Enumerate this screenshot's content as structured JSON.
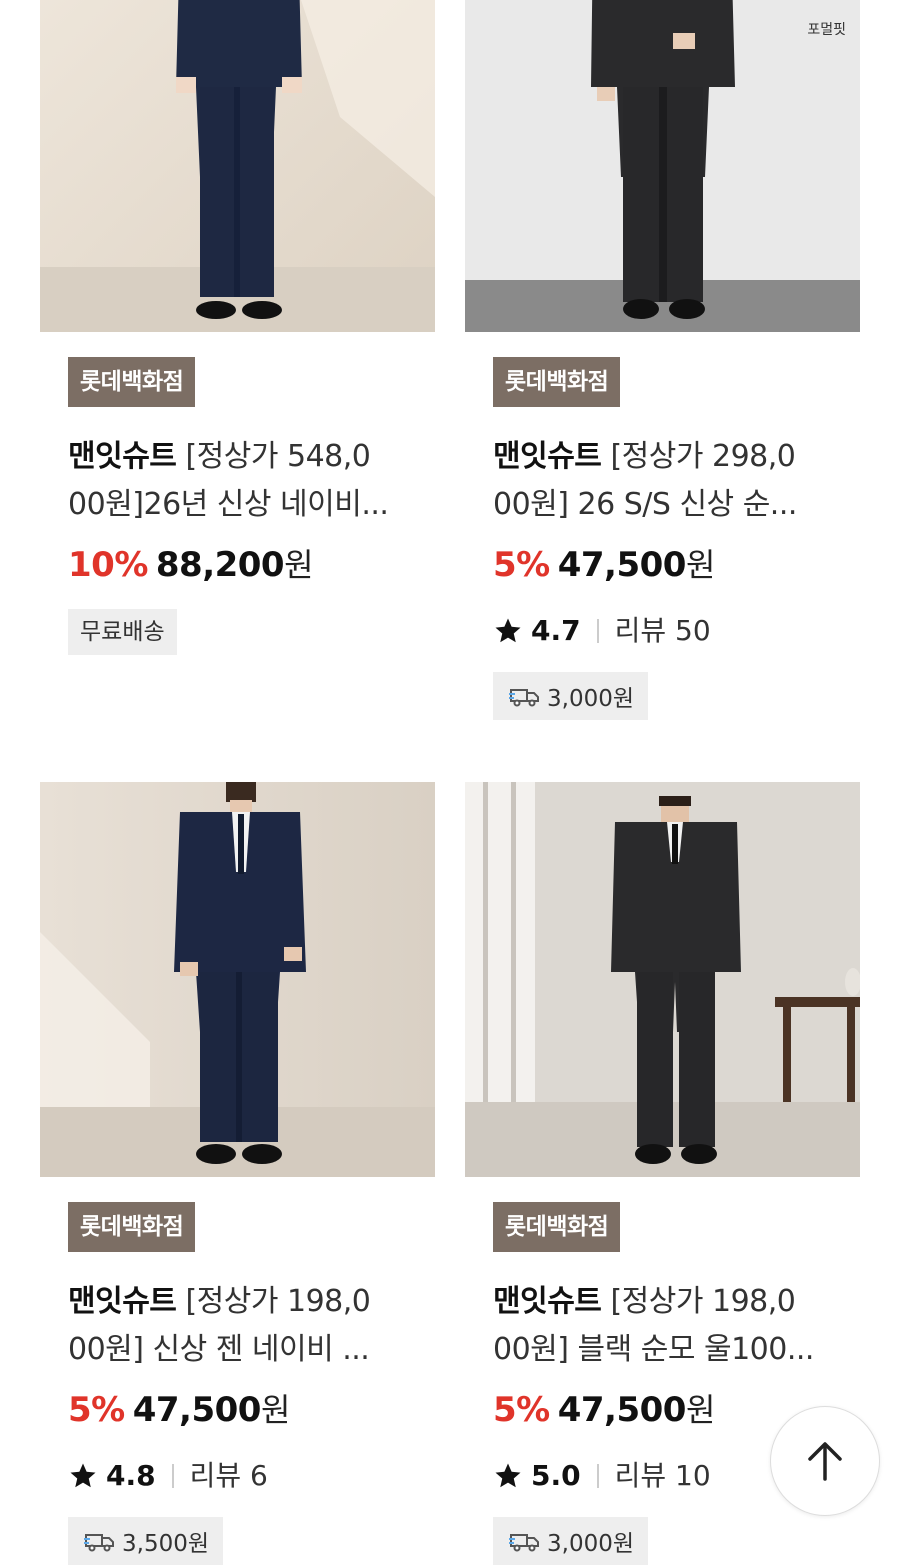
{
  "colors": {
    "discount": "#e0342a",
    "store_badge_bg": "#7c6e64",
    "tag_bg": "#eeeeee",
    "delivery_icon_accent": "#5aa7e8"
  },
  "products": [
    {
      "store": "롯데백화점",
      "brand": "맨잇슈트",
      "title_line1": "[정상가 548,0",
      "title_line2": "00원]26년 신상 네이비...",
      "discount": "10%",
      "price": "88,200",
      "currency": "원",
      "free_shipping": "무료배송"
    },
    {
      "store": "롯데백화점",
      "brand": "맨잇슈트",
      "title_line1": "[정상가 298,0",
      "title_line2": "00원] 26 S/S 신상 순...",
      "discount": "5%",
      "price": "47,500",
      "currency": "원",
      "rating": "4.7",
      "reviews": "리뷰 50",
      "shipping_fee": "3,000원",
      "image_label": "포멀핏"
    },
    {
      "store": "롯데백화점",
      "brand": "맨잇슈트",
      "title_line1": "[정상가 198,0",
      "title_line2": "00원] 신상 젠 네이비 ...",
      "discount": "5%",
      "price": "47,500",
      "currency": "원",
      "rating": "4.8",
      "reviews": "리뷰 6",
      "shipping_fee": "3,500원"
    },
    {
      "store": "롯데백화점",
      "brand": "맨잇슈트",
      "title_line1": "[정상가 198,0",
      "title_line2": "00원] 블랙 순모 울100...",
      "discount": "5%",
      "price": "47,500",
      "currency": "원",
      "rating": "5.0",
      "reviews": "리뷰 10",
      "shipping_fee": "3,000원"
    }
  ],
  "scroll_top_icon": "arrow-up-icon"
}
